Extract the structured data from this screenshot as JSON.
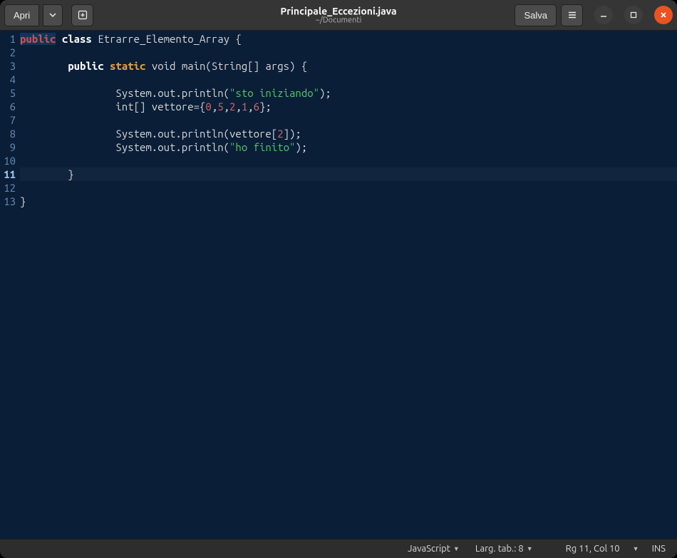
{
  "titlebar": {
    "open_label": "Apri",
    "save_label": "Salva",
    "title": "Principale_Eccezioni.java",
    "subtitle": "~/Documenti"
  },
  "code": {
    "class_name": "Etrarre_Elemento_Array",
    "main_sig_prefix": "void main(String[] args) {",
    "println1_str": "\"sto iniziando\"",
    "vettore_decl_prefix": "int[] vettore={",
    "vettore_values": [
      "0",
      "5",
      "2",
      "1",
      "6"
    ],
    "vettore_decl_suffix": "};",
    "println_vettore_index": "2",
    "println2_str": "\"ho finito\"",
    "kw_public": "public",
    "kw_class": "class",
    "kw_static": "static",
    "sysout": "System.out.println"
  },
  "gutter": {
    "lines": [
      "1",
      "2",
      "3",
      "4",
      "5",
      "6",
      "7",
      "8",
      "9",
      "10",
      "11",
      "12",
      "13"
    ],
    "current": "11"
  },
  "statusbar": {
    "language": "JavaScript",
    "tab_label": "Larg. tab.: 8",
    "position": "Rg 11, Col 10",
    "insert_mode": "INS"
  }
}
